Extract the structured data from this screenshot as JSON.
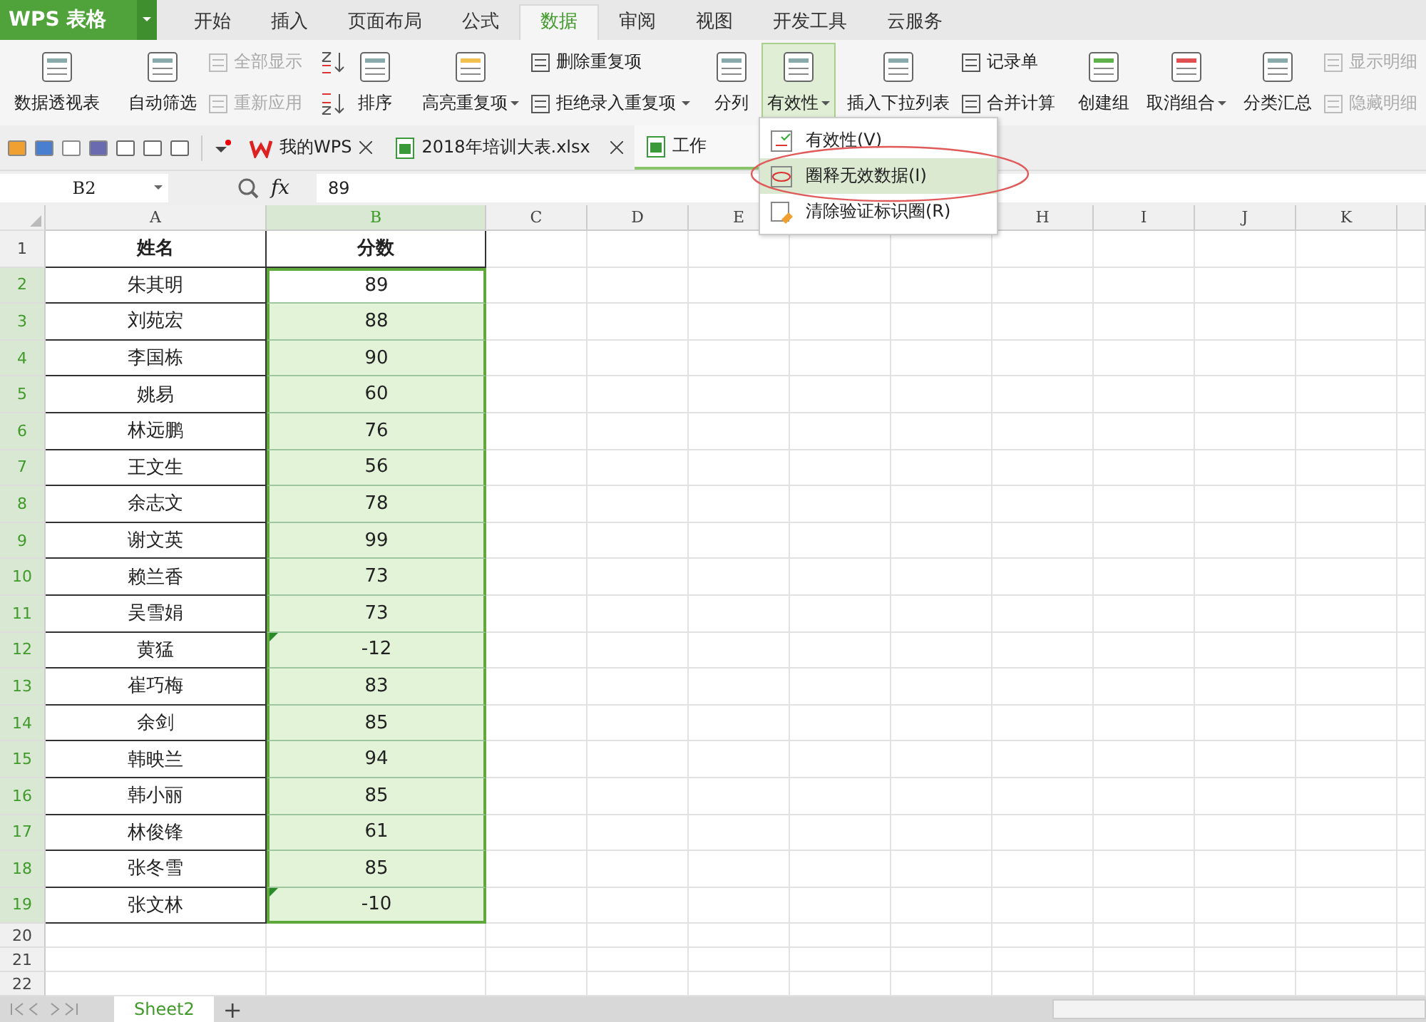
{
  "app": {
    "logo": "WPS 表格"
  },
  "menu_tabs": [
    {
      "label": "开始",
      "selected": false
    },
    {
      "label": "插入",
      "selected": false
    },
    {
      "label": "页面布局",
      "selected": false
    },
    {
      "label": "公式",
      "selected": false
    },
    {
      "label": "数据",
      "selected": true
    },
    {
      "label": "审阅",
      "selected": false
    },
    {
      "label": "视图",
      "selected": false
    },
    {
      "label": "开发工具",
      "selected": false
    },
    {
      "label": "云服务",
      "selected": false
    }
  ],
  "ribbon": [
    {
      "items": [
        {
          "kind": "large",
          "label": "数据透视表",
          "dropdown": false,
          "selected": false
        }
      ]
    },
    {
      "items": [
        {
          "kind": "large",
          "label": "自动筛选",
          "dropdown": false,
          "selected": false
        },
        {
          "kind": "stack",
          "items": [
            {
              "label": "全部显示",
              "disabled": true,
              "dropdown": false
            },
            {
              "label": "重新应用",
              "disabled": true,
              "dropdown": false
            }
          ]
        }
      ]
    },
    {
      "items": [
        {
          "kind": "sort_icons"
        },
        {
          "kind": "large",
          "label": "排序",
          "dropdown": false,
          "selected": false
        }
      ]
    },
    {
      "items": [
        {
          "kind": "large",
          "label": "高亮重复项",
          "dropdown": true,
          "selected": false
        },
        {
          "kind": "stack",
          "items": [
            {
              "label": "删除重复项",
              "disabled": false,
              "dropdown": false
            },
            {
              "label": "拒绝录入重复项",
              "disabled": false,
              "dropdown": true
            }
          ]
        }
      ]
    },
    {
      "items": [
        {
          "kind": "large",
          "label": "分列",
          "dropdown": false,
          "selected": false
        },
        {
          "kind": "large",
          "label": "有效性",
          "dropdown": true,
          "selected": true
        },
        {
          "kind": "large",
          "label": "插入下拉列表",
          "dropdown": false,
          "selected": false
        },
        {
          "kind": "stack",
          "items": [
            {
              "label": "记录单",
              "disabled": false,
              "dropdown": false
            },
            {
              "label": "合并计算",
              "disabled": false,
              "dropdown": false
            }
          ]
        }
      ]
    },
    {
      "items": [
        {
          "kind": "large",
          "label": "创建组",
          "dropdown": false,
          "selected": false
        },
        {
          "kind": "large",
          "label": "取消组合",
          "dropdown": true,
          "selected": false
        },
        {
          "kind": "large",
          "label": "分类汇总",
          "dropdown": false,
          "selected": false
        },
        {
          "kind": "stack",
          "items": [
            {
              "label": "显示明细",
              "disabled": true,
              "dropdown": false
            },
            {
              "label": "隐藏明细",
              "disabled": true,
              "dropdown": false
            }
          ]
        }
      ]
    }
  ],
  "doc_tabs": [
    {
      "label": "我的WPS",
      "kind": "home",
      "selected": false,
      "closable": true
    },
    {
      "label": "2018年培训大表.xlsx",
      "kind": "sheet",
      "selected": false,
      "closable": true
    },
    {
      "label": "工作",
      "kind": "sheet",
      "selected": true,
      "closable": false
    }
  ],
  "formula_bar": {
    "cell_ref": "B2",
    "fx": "fx",
    "value": "89"
  },
  "columns": [
    {
      "kind": "label",
      "label": "A",
      "selected": false
    },
    {
      "kind": "label",
      "label": "B",
      "selected": true
    },
    {
      "kind": "label",
      "label": "C",
      "selected": false
    },
    {
      "kind": "label",
      "label": "D",
      "selected": false
    },
    {
      "kind": "label",
      "label": "E",
      "selected": false
    },
    {
      "kind": "covered"
    },
    {
      "kind": "covered"
    },
    {
      "kind": "label",
      "label": "H",
      "selected": false
    },
    {
      "kind": "label",
      "label": "I",
      "selected": false
    },
    {
      "kind": "label",
      "label": "J",
      "selected": false
    },
    {
      "kind": "label",
      "label": "K",
      "selected": false
    }
  ],
  "header_row": {
    "num": "1",
    "cells": [
      "姓名",
      "分数"
    ]
  },
  "rows": [
    {
      "num": "2",
      "name": "朱其明",
      "score": "89",
      "selected": true,
      "active": true,
      "flag": false
    },
    {
      "num": "3",
      "name": "刘苑宏",
      "score": "88",
      "selected": true,
      "active": false,
      "flag": false
    },
    {
      "num": "4",
      "name": "李国栋",
      "score": "90",
      "selected": true,
      "active": false,
      "flag": false
    },
    {
      "num": "5",
      "name": "姚易",
      "score": "60",
      "selected": true,
      "active": false,
      "flag": false
    },
    {
      "num": "6",
      "name": "林远鹏",
      "score": "76",
      "selected": true,
      "active": false,
      "flag": false
    },
    {
      "num": "7",
      "name": "王文生",
      "score": "56",
      "selected": true,
      "active": false,
      "flag": false
    },
    {
      "num": "8",
      "name": "余志文",
      "score": "78",
      "selected": true,
      "active": false,
      "flag": false
    },
    {
      "num": "9",
      "name": "谢文英",
      "score": "99",
      "selected": true,
      "active": false,
      "flag": false
    },
    {
      "num": "10",
      "name": "赖兰香",
      "score": "73",
      "selected": true,
      "active": false,
      "flag": false
    },
    {
      "num": "11",
      "name": "吴雪娟",
      "score": "73",
      "selected": true,
      "active": false,
      "flag": false
    },
    {
      "num": "12",
      "name": "黄猛",
      "score": "-12",
      "selected": true,
      "active": false,
      "flag": true
    },
    {
      "num": "13",
      "name": "崔巧梅",
      "score": "83",
      "selected": true,
      "active": false,
      "flag": false
    },
    {
      "num": "14",
      "name": "余剑",
      "score": "85",
      "selected": true,
      "active": false,
      "flag": false
    },
    {
      "num": "15",
      "name": "韩映兰",
      "score": "94",
      "selected": true,
      "active": false,
      "flag": false
    },
    {
      "num": "16",
      "name": "韩小丽",
      "score": "85",
      "selected": true,
      "active": false,
      "flag": false
    },
    {
      "num": "17",
      "name": "林俊锋",
      "score": "61",
      "selected": true,
      "active": false,
      "flag": false
    },
    {
      "num": "18",
      "name": "张冬雪",
      "score": "85",
      "selected": true,
      "active": false,
      "flag": false
    },
    {
      "num": "19",
      "name": "张文林",
      "score": "-10",
      "selected": true,
      "active": false,
      "flag": true
    }
  ],
  "empty_rows": [
    "20",
    "21",
    "22"
  ],
  "sheet_tabs": [
    {
      "label": "Sheet2",
      "selected": true
    }
  ],
  "add_sheet": "+",
  "dropdown": {
    "items": [
      {
        "label": "有效性(V)",
        "selected": false,
        "kind": "validity"
      },
      {
        "label": "圈释无效数据(I)",
        "selected": true,
        "kind": "circle"
      },
      {
        "label": "清除验证标识圈(R)",
        "selected": false,
        "kind": "clear"
      }
    ],
    "annotation": true
  }
}
